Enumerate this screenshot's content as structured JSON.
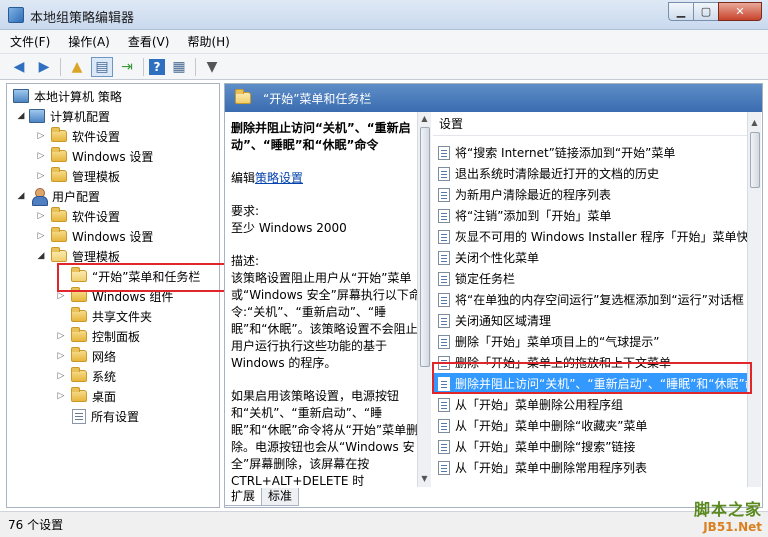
{
  "window": {
    "title": "本地组策略编辑器"
  },
  "menu": [
    "文件(F)",
    "操作(A)",
    "查看(V)",
    "帮助(H)"
  ],
  "tree": {
    "root": "本地计算机 策略",
    "computer_config": "计算机配置",
    "user_config": "用户配置",
    "software": "软件设置",
    "windows": "Windows 设置",
    "admin_templates": "管理模板",
    "start_menu": "“开始”菜单和任务栏",
    "windows_components": "Windows 组件",
    "shared_folders": "共享文件夹",
    "control_panel": "控制面板",
    "network": "网络",
    "system": "系统",
    "desktop": "桌面",
    "all_settings": "所有设置"
  },
  "panel": {
    "header": "“开始”菜单和任务栏",
    "desc_title": "删除并阻止访问“关机”、“重新启动”、“睡眠”和“休眠”命令",
    "edit_prefix": "编辑",
    "edit_link": "策略设置",
    "req_label": "要求:",
    "req_value": "至少 Windows 2000",
    "desc_label": "描述:",
    "desc_body1": "该策略设置阻止用户从“开始”菜单或“Windows 安全”屏幕执行以下命令:“关机”、“重新启动”、“睡眠”和“休眠”。该策略设置不会阻止用户运行执行这些功能的基于 Windows 的程序。",
    "desc_body2": "如果启用该策略设置，电源按钮和“关机”、“重新启动”、“睡眠”和“休眠”命令将从“开始”菜单删除。电源按钮也会从“Windows 安全”屏幕删除，该屏幕在按 CTRL+ALT+DELETE 时"
  },
  "list": {
    "header": "设置",
    "rows": [
      "将“搜索 Internet”链接添加到“开始”菜单",
      "退出系统时清除最近打开的文档的历史",
      "为新用户清除最近的程序列表",
      "将“注销”添加到「开始」菜单",
      "灰显不可用的 Windows Installer 程序「开始」菜单快捷方式",
      "关闭个性化菜单",
      "锁定任务栏",
      "将“在单独的内存空间运行”复选框添加到“运行”对话框",
      "关闭通知区域清理",
      "删除「开始」菜单项目上的“气球提示”",
      "删除「开始」菜单上的拖放和上下文菜单",
      "删除并阻止访问“关机”、“重新启动”、“睡眠”和“休眠”命令",
      "从「开始」菜单删除公用程序组",
      "从「开始」菜单中删除“收藏夹”菜单",
      "从「开始」菜单中删除“搜索”链接",
      "从「开始」菜单中删除常用程序列表"
    ],
    "selected_index": 11
  },
  "tabs": [
    "扩展",
    "标准"
  ],
  "status": "76 个设置",
  "watermark": {
    "line1": "脚本之家",
    "line2": "JB51.Net"
  }
}
